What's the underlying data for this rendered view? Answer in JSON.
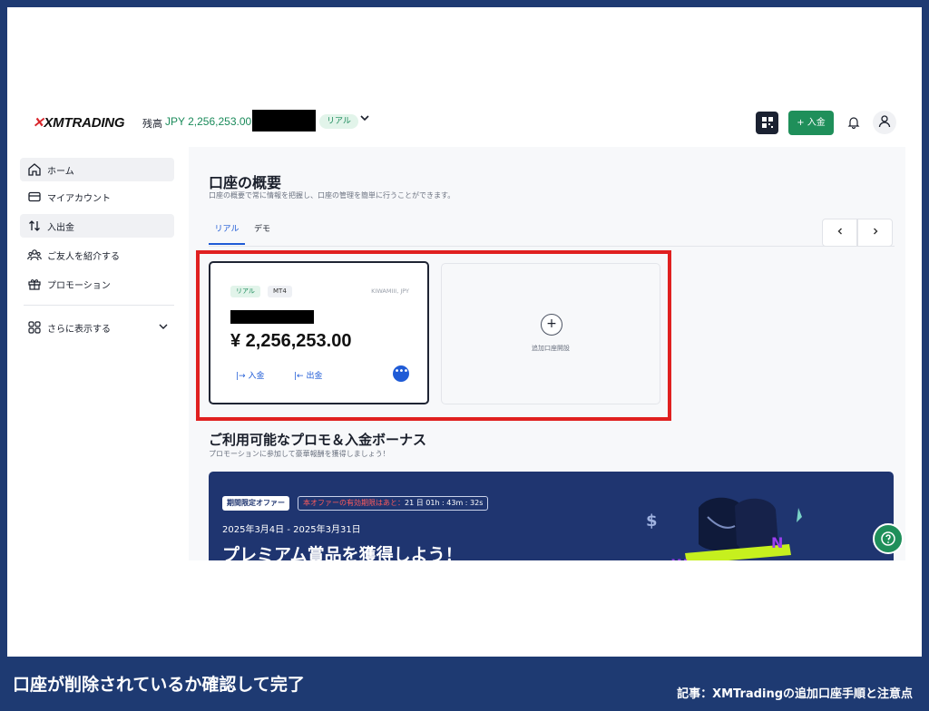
{
  "header": {
    "logo": "XMTRADING",
    "balance_label": "残高",
    "balance_value": "JPY 2,256,253.00",
    "account_type_badge": "リアル",
    "deposit_button": "+ 入金"
  },
  "sidebar": {
    "items": [
      {
        "label": "ホーム",
        "icon": "home-icon"
      },
      {
        "label": "マイアカウント",
        "icon": "card-icon"
      },
      {
        "label": "入出金",
        "icon": "transfer-icon"
      },
      {
        "label": "ご友人を紹介する",
        "icon": "people-icon"
      },
      {
        "label": "プロモーション",
        "icon": "gift-icon"
      }
    ],
    "more": {
      "label": "さらに表示する",
      "icon": "grid-icon"
    }
  },
  "main": {
    "title": "口座の概要",
    "subtitle": "口座の概要で常に情報を把握し、口座の管理を簡単に行うことができます。",
    "tabs": [
      {
        "label": "リアル",
        "active": true
      },
      {
        "label": "デモ",
        "active": false
      }
    ],
    "account_card": {
      "tag_type": "リアル",
      "tag_platform": "MT4",
      "account_id": "KIWAMIII, JPY",
      "balance": "¥ 2,256,253.00",
      "deposit": "入金",
      "withdraw": "出金"
    },
    "add_card": {
      "label": "追加口座開設"
    },
    "promo": {
      "title": "ご利用可能なプロモ＆入金ボーナス",
      "subtitle": "プロモーションに参加して豪華報酬を獲得しましょう！",
      "badge": "期間限定オファー",
      "timer_prefix": "本オファーの有効期限はあと：",
      "timer_value": "21 日 01h : 43m : 32s",
      "dates": "2025年3月4日 - 2025年3月31日",
      "headline": "プレミアム賞品を獲得しよう！"
    }
  },
  "caption": {
    "left": "口座が削除されているか確認して完了",
    "right": "記事：XMTradingの追加口座手順と注意点"
  },
  "colors": {
    "brand_green": "#1f8f5a",
    "link_blue": "#1f5bd6",
    "highlight_red": "#e02020",
    "footer_navy": "#1e3a72"
  }
}
